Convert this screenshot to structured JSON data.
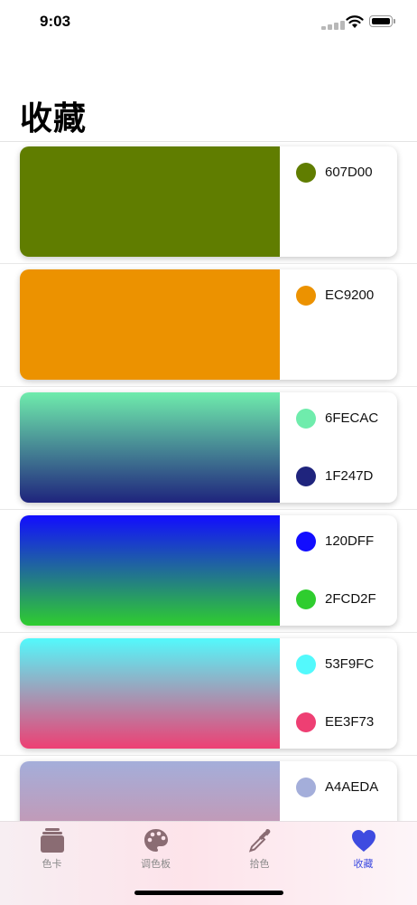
{
  "status_bar": {
    "time": "9:03"
  },
  "page": {
    "title": "收藏"
  },
  "cards": [
    {
      "colors": [
        {
          "hex": "607D00",
          "color": "#607D00"
        },
        {
          "hex": "",
          "color": "#FFFFFF"
        }
      ]
    },
    {
      "colors": [
        {
          "hex": "EC9200",
          "color": "#EC9200"
        },
        {
          "hex": "",
          "color": "#FFFFFF"
        }
      ]
    },
    {
      "colors": [
        {
          "hex": "6FECAC",
          "color": "#6FECAC"
        },
        {
          "hex": "1F247D",
          "color": "#1F247D"
        }
      ]
    },
    {
      "colors": [
        {
          "hex": "120DFF",
          "color": "#120DFF"
        },
        {
          "hex": "2FCD2F",
          "color": "#2FCD2F"
        }
      ]
    },
    {
      "colors": [
        {
          "hex": "53F9FC",
          "color": "#53F9FC"
        },
        {
          "hex": "EE3F73",
          "color": "#EE3F73"
        }
      ]
    },
    {
      "colors": [
        {
          "hex": "A4AEDA",
          "color": "#A4AEDA"
        },
        {
          "hex": "",
          "color": "#D98A9C"
        }
      ]
    }
  ],
  "tab_bar": {
    "tabs": [
      {
        "label": "色卡",
        "icon": "card-stack-icon"
      },
      {
        "label": "调色板",
        "icon": "palette-icon"
      },
      {
        "label": "拾色",
        "icon": "eyedropper-icon"
      },
      {
        "label": "收藏",
        "icon": "heart-icon"
      }
    ],
    "active_index": 3,
    "active_color": "#3E4BE0",
    "inactive_color": "#8A8A8A"
  }
}
